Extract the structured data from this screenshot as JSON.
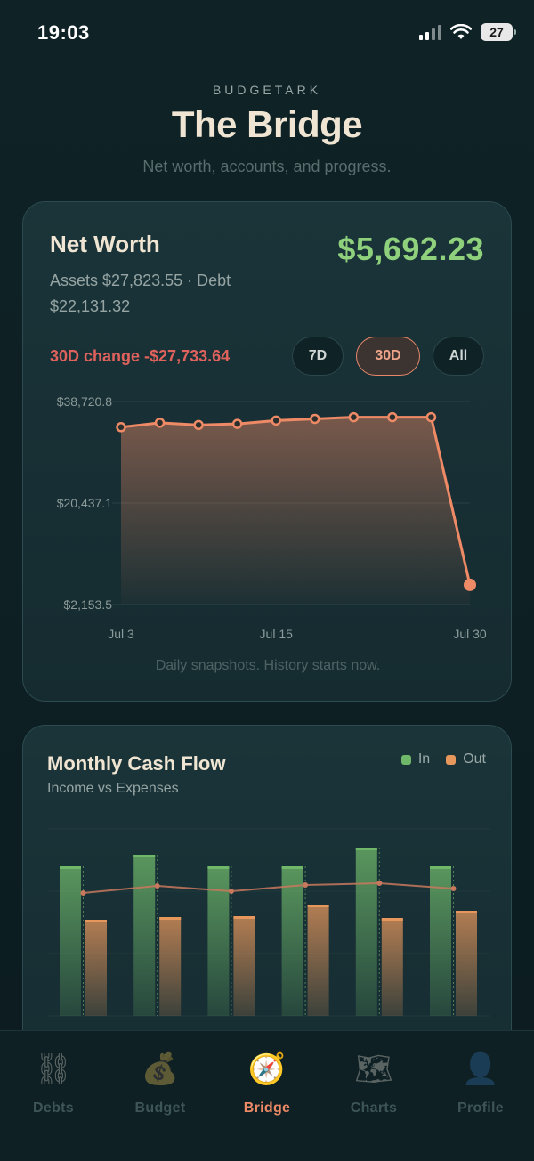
{
  "status": {
    "time": "19:03",
    "battery": "27"
  },
  "header": {
    "brand": "BUDGETARK",
    "title": "The Bridge",
    "subtitle": "Net worth, accounts, and progress."
  },
  "net_worth": {
    "title": "Net Worth",
    "value": "$5,692.23",
    "assets_line": "Assets $27,823.55 · Debt $22,131.32",
    "change_text": "30D change -$27,733.64",
    "ranges": [
      "7D",
      "30D",
      "All"
    ],
    "active_range": "30D",
    "caption": "Daily snapshots. History starts now.",
    "accent": "#ee8a66",
    "positive": "#8fd07d",
    "negative": "#e0625c"
  },
  "chart_data": [
    {
      "type": "area",
      "y_ticks": [
        "$38,720.8",
        "$20,437.1",
        "$2,153.5"
      ],
      "ylim": [
        2153.5,
        38720.8
      ],
      "x_ticks": [
        "Jul 3",
        "Jul 15",
        "Jul 30"
      ],
      "x": [
        3,
        6,
        9,
        12,
        15,
        18,
        21,
        24,
        27,
        30
      ],
      "values": [
        34100,
        34900,
        34500,
        34700,
        35300,
        35600,
        35900,
        35900,
        35900,
        5692.23
      ]
    },
    {
      "type": "bar",
      "title": "Monthly Cash Flow",
      "subtitle": "Income vs Expenses",
      "categories": [
        "",
        "",
        "",
        "",
        "",
        ""
      ],
      "series": [
        {
          "name": "In",
          "color": "#6fb86a",
          "values": [
            168,
            181,
            168,
            168,
            189,
            168
          ]
        },
        {
          "name": "Out",
          "color": "#e7975c",
          "values": [
            108,
            111,
            112,
            125,
            110,
            118
          ]
        }
      ],
      "line_values": [
        138,
        146,
        140,
        147,
        149,
        143
      ],
      "ylim": [
        0,
        210
      ]
    }
  ],
  "tabs": [
    {
      "label": "Debts",
      "icon": "chain-icon",
      "glyph": "⛓"
    },
    {
      "label": "Budget",
      "icon": "money-bag-icon",
      "glyph": "💰"
    },
    {
      "label": "Bridge",
      "icon": "compass-icon",
      "glyph": "🧭"
    },
    {
      "label": "Charts",
      "icon": "map-icon",
      "glyph": "🗺"
    },
    {
      "label": "Profile",
      "icon": "person-icon",
      "glyph": "👤"
    }
  ],
  "active_tab": "Bridge"
}
